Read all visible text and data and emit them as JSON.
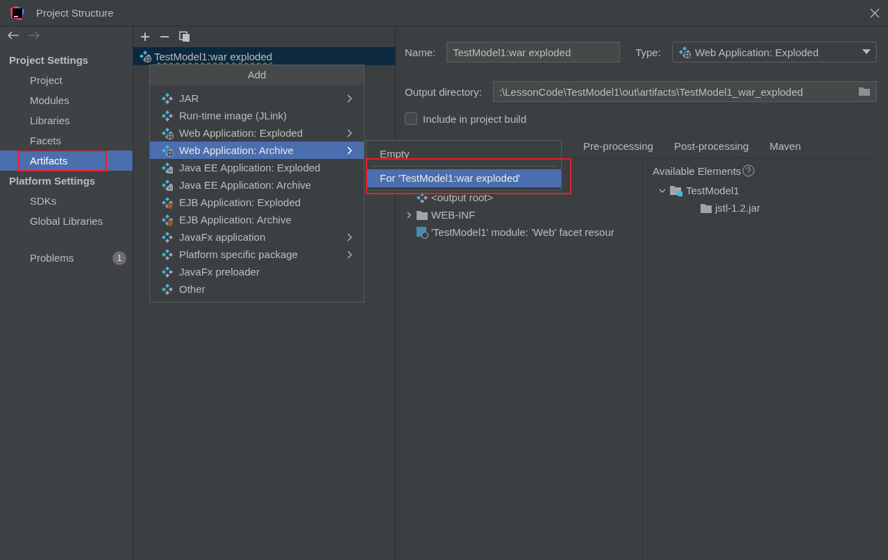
{
  "window": {
    "title": "Project Structure"
  },
  "sidebar": {
    "sections": [
      {
        "title": "Project Settings",
        "items": [
          {
            "label": "Project",
            "selected": false,
            "highlighted": false
          },
          {
            "label": "Modules",
            "selected": false,
            "highlighted": false
          },
          {
            "label": "Libraries",
            "selected": false,
            "highlighted": false
          },
          {
            "label": "Facets",
            "selected": false,
            "highlighted": false
          },
          {
            "label": "Artifacts",
            "selected": true,
            "highlighted": true
          }
        ]
      },
      {
        "title": "Platform Settings",
        "items": [
          {
            "label": "SDKs",
            "selected": false,
            "highlighted": false
          },
          {
            "label": "Global Libraries",
            "selected": false,
            "highlighted": false
          }
        ]
      }
    ],
    "problems": {
      "label": "Problems",
      "count": "1"
    }
  },
  "artifacts": [
    {
      "label": "TestModel1:war exploded",
      "selected": true
    }
  ],
  "add_menu": {
    "title": "Add",
    "items": [
      {
        "label": "JAR",
        "kind": "plain",
        "submenu": true,
        "selected": false
      },
      {
        "label": "Run-time image (JLink)",
        "kind": "plain",
        "submenu": false,
        "selected": false
      },
      {
        "label": "Web Application: Exploded",
        "kind": "web",
        "submenu": true,
        "selected": false
      },
      {
        "label": "Web Application: Archive",
        "kind": "web",
        "submenu": true,
        "selected": true
      },
      {
        "label": "Java EE Application: Exploded",
        "kind": "ee",
        "submenu": false,
        "selected": false
      },
      {
        "label": "Java EE Application: Archive",
        "kind": "ee",
        "submenu": false,
        "selected": false
      },
      {
        "label": "EJB Application: Exploded",
        "kind": "ejb",
        "submenu": false,
        "selected": false
      },
      {
        "label": "EJB Application: Archive",
        "kind": "ejb",
        "submenu": false,
        "selected": false
      },
      {
        "label": "JavaFx application",
        "kind": "plain",
        "submenu": true,
        "selected": false
      },
      {
        "label": "Platform specific package",
        "kind": "plain",
        "submenu": true,
        "selected": false
      },
      {
        "label": "JavaFx preloader",
        "kind": "plain",
        "submenu": false,
        "selected": false
      },
      {
        "label": "Other",
        "kind": "plain",
        "submenu": false,
        "selected": false
      }
    ]
  },
  "submenu": [
    {
      "label": "Empty",
      "selected": false,
      "highlighted": false
    },
    {
      "label": "For 'TestModel1:war exploded'",
      "selected": true,
      "highlighted": true
    }
  ],
  "details": {
    "name_label": "Name:",
    "name_value": "TestModel1:war exploded",
    "type_label": "Type:",
    "type_value": "Web Application: Exploded",
    "output_label": "Output directory:",
    "output_value": ":\\LessonCode\\TestModel1\\out\\artifacts\\TestModel1_war_exploded",
    "include_build": {
      "label": "Include in project build",
      "checked": false
    },
    "tabs": [
      {
        "label": "Pre-processing",
        "selected": false
      },
      {
        "label": "Post-processing",
        "selected": false
      },
      {
        "label": "Maven",
        "selected": false
      }
    ],
    "layout_tree": [
      {
        "label": "<output root>",
        "kind": "root",
        "children": [
          {
            "label": "WEB-INF",
            "kind": "folder",
            "expanded": false
          },
          {
            "label": "'TestModel1' module: 'Web' facet resour",
            "kind": "facet"
          }
        ]
      }
    ],
    "available": {
      "title": "Available Elements",
      "tree": [
        {
          "label": "TestModel1",
          "kind": "module",
          "expanded": true,
          "children": [
            {
              "label": "jstl-1.2.jar",
              "kind": "library"
            }
          ]
        }
      ]
    }
  }
}
